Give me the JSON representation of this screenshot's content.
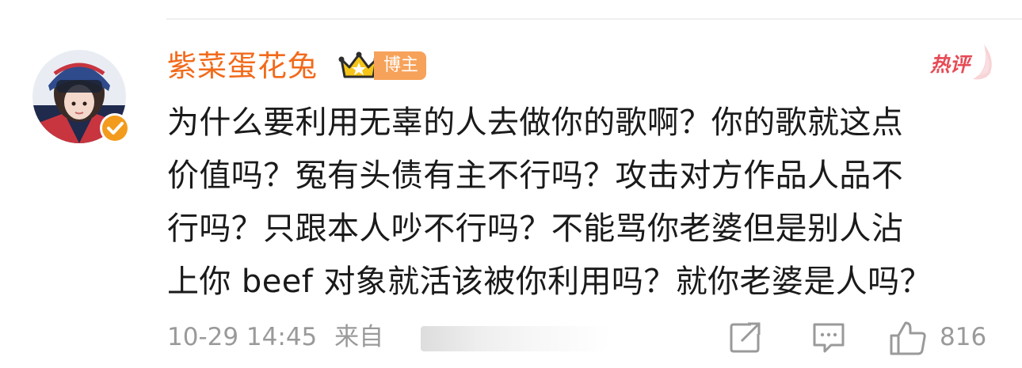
{
  "comment": {
    "username": "紫菜蛋花兔",
    "role_badge": "博主",
    "hot_tag": "热评",
    "body_lines": [
      "为什么要利用无辜的人去做你的歌啊？你的歌就这点",
      "价值吗？冤有头债有主不行吗？攻击对方作品人品不",
      "行吗？只跟本人吵不行吗？不能骂你老婆但是别人沾",
      "上你 beef 对象就活该被你利用吗？就你老婆是人吗？"
    ],
    "timestamp": "10-29 14:45",
    "source_prefix": "来自",
    "like_count": "816",
    "icons": {
      "verified": "verified-check-icon",
      "crown": "crown-icon",
      "share": "share-edit-icon",
      "reply": "comment-bubble-icon",
      "like": "thumbs-up-icon"
    },
    "colors": {
      "username": "#f26a1b",
      "role_badge_bg": "#f7a25a",
      "hot_tag": "#e64b56",
      "meta_text": "#9a9a9a",
      "verified_badge": "#f39b1c"
    }
  }
}
